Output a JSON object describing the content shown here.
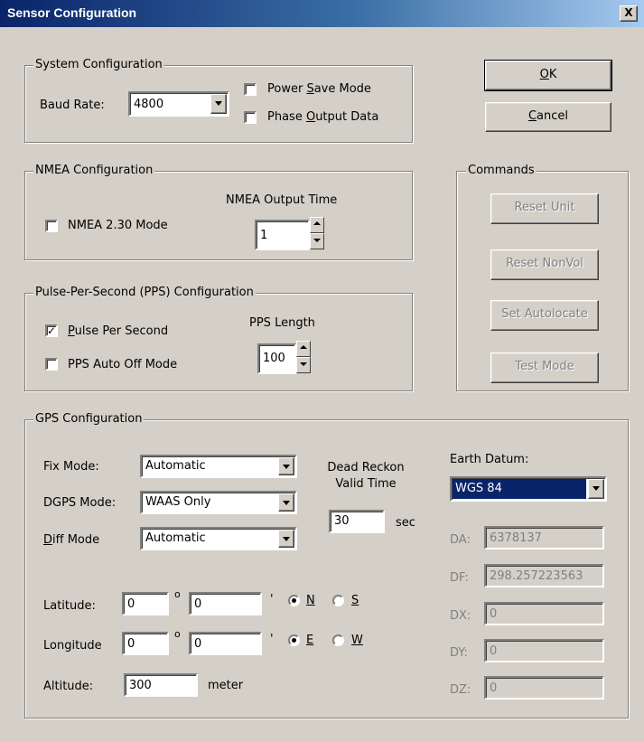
{
  "window": {
    "title": "Sensor Configuration",
    "close_label": "X"
  },
  "system": {
    "legend": "System Configuration",
    "baud_label": "Baud Rate:",
    "baud_value": "4800",
    "power_save_pre": "Power ",
    "power_save_ul": "S",
    "power_save_post": "ave Mode",
    "power_save_checked": false,
    "phase_pre": "Phase ",
    "phase_ul": "O",
    "phase_post": "utput Data",
    "phase_checked": false
  },
  "buttons": {
    "ok_ul": "O",
    "ok_post": "K",
    "cancel_ul": "C",
    "cancel_post": "ancel"
  },
  "nmea": {
    "legend": "NMEA Configuration",
    "mode_label": "NMEA 2.30 Mode",
    "mode_checked": false,
    "output_time_label": "NMEA Output Time",
    "output_time_value": "1"
  },
  "commands": {
    "legend": "Commands",
    "reset_unit": "Reset Unit",
    "reset_nonvol": "Reset NonVol",
    "set_autolocate": "Set Autolocate",
    "test_mode": "Test Mode"
  },
  "pps": {
    "legend": "Pulse-Per-Second (PPS) Configuration",
    "pps_ul": "P",
    "pps_post": "ulse Per Second",
    "pps_checked": true,
    "auto_off_label": "PPS Auto Off Mode",
    "auto_off_checked": false,
    "length_label": "PPS Length",
    "length_value": "100"
  },
  "gps": {
    "legend": "GPS Configuration",
    "fix_mode_label": "Fix Mode:",
    "fix_mode_value": "Automatic",
    "dgps_mode_label": "DGPS Mode:",
    "dgps_mode_value": "WAAS Only",
    "diff_mode_ul": "D",
    "diff_mode_post": "iff Mode",
    "diff_mode_value": "Automatic",
    "dead_reckon_line1": "Dead Reckon",
    "dead_reckon_line2": "Valid Time",
    "dead_reckon_value": "30",
    "dead_reckon_unit": "sec",
    "earth_datum_label": "Earth Datum:",
    "earth_datum_value": "WGS 84",
    "latitude_label": "Latitude:",
    "lat_deg": "0",
    "lat_min": "0",
    "north_label": "N",
    "south_label": "S",
    "lat_hemisphere": "N",
    "longitude_label": "Longitude",
    "lon_deg": "0",
    "lon_min": "0",
    "east_label": "E",
    "west_label": "W",
    "lon_hemisphere": "E",
    "altitude_label": "Altitude:",
    "altitude_value": "300",
    "altitude_unit": "meter",
    "degree_symbol": "o",
    "minute_symbol": "'",
    "da_label": "DA:",
    "da_value": "6378137",
    "df_label": "DF:",
    "df_value": "298.257223563",
    "dx_label": "DX:",
    "dx_value": "0",
    "dy_label": "DY:",
    "dy_value": "0",
    "dz_label": "DZ:",
    "dz_value": "0"
  }
}
